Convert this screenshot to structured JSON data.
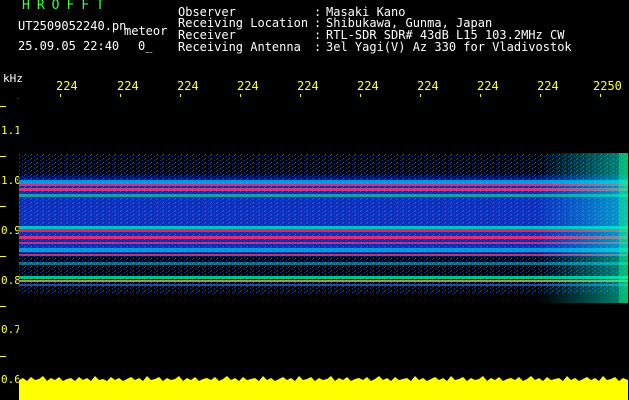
{
  "header": {
    "app_title": "HROFFT",
    "file_name": "UT2509052240.pn",
    "file_tag": "meteor",
    "date_time": "25.09.05 22:40",
    "count": "0_"
  },
  "station_info": [
    {
      "label": "Observer",
      "value": "Masaki Kano"
    },
    {
      "label": "Receiving Location",
      "value": "Shibukawa, Gunma, Japan"
    },
    {
      "label": "Receiver",
      "value": "RTL-SDR SDR# 43dB L15 103.2MHz CW"
    },
    {
      "label": "Receiving Antenna",
      "value": "3el Yagi(V) Az 330 for Vladivostok"
    }
  ],
  "plot": {
    "freq_unit": "kHz",
    "time_ticks": [
      "224",
      "224",
      "224",
      "224",
      "224",
      "224",
      "224",
      "224",
      "224",
      "2250"
    ],
    "freq_ticks": [
      "1.1",
      "1.0",
      "0.9",
      "0.8",
      "0.7",
      "0.6"
    ],
    "colors": {
      "background": "#000000",
      "tick_text": "#ffff33",
      "title_green": "#3cff3c",
      "level_bar": "#ffff00"
    }
  }
}
